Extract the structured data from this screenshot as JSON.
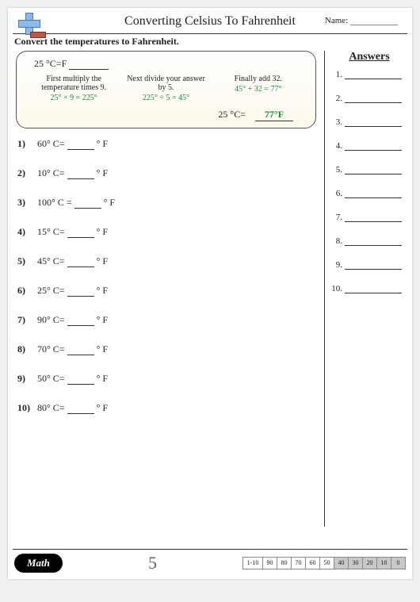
{
  "header": {
    "title": "Converting Celsius To Fahrenheit",
    "name_label": "Name:"
  },
  "instruction": "Convert the temperatures to Fahrenheit.",
  "example": {
    "prompt": "25 °C=F",
    "step1_instr": "First multiply the temperature times 9.",
    "step1_calc": "25° × 9 = 225°",
    "step2_instr": "Next divide your answer by 5.",
    "step2_calc": "225° ÷ 5 = 45°",
    "step3_instr": "Finally add 32.",
    "step3_calc": "45° + 32 = 77°",
    "result_left": "25 °C=",
    "result_val": "77°F"
  },
  "problems": [
    {
      "n": "1)",
      "left": "60° C=",
      "right": "° F"
    },
    {
      "n": "2)",
      "left": "10° C=",
      "right": "° F"
    },
    {
      "n": "3)",
      "left": "100° C",
      "mid": "=",
      "right": "° F"
    },
    {
      "n": "4)",
      "left": "15° C=",
      "right": "° F"
    },
    {
      "n": "5)",
      "left": "45° C=",
      "right": "° F"
    },
    {
      "n": "6)",
      "left": "25° C=",
      "right": "° F"
    },
    {
      "n": "7)",
      "left": "90° C=",
      "right": "° F"
    },
    {
      "n": "8)",
      "left": "70° C=",
      "right": "° F"
    },
    {
      "n": "9)",
      "left": "50° C=",
      "right": "° F"
    },
    {
      "n": "10)",
      "left": "80° C=",
      "right": "° F"
    }
  ],
  "answers": {
    "title": "Answers",
    "lines": [
      "1.",
      "2.",
      "3.",
      "4.",
      "5.",
      "6.",
      "7.",
      "8.",
      "9.",
      "10."
    ]
  },
  "footer": {
    "badge": "Math",
    "page": "5",
    "scores": [
      "1-10",
      "90",
      "80",
      "70",
      "60",
      "50",
      "40",
      "30",
      "20",
      "10",
      "0"
    ]
  }
}
